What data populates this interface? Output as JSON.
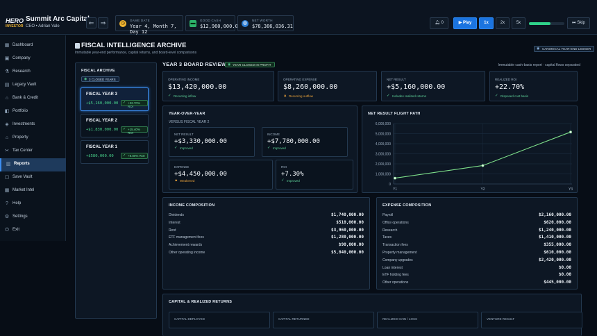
{
  "topbar": {
    "logo_top": "HERO",
    "logo_bottom": "INVESTOR",
    "company": "Summit Arc Capital",
    "ceo": "CEO • Adrian Vale",
    "back_icon": "arrow-left-icon",
    "forward_icon": "arrow-right-icon",
    "game_date_label": "GAME DATE",
    "game_date": "Year 4, Month 7, Day 12",
    "cash_label": "GOOD CASH",
    "cash": "$12,960,000.00",
    "net_worth_label": "NET WORTH",
    "net_worth": "$78,386,036.31",
    "notifications": "0",
    "play": "Play",
    "speed_1": "1x",
    "speed_2": "2x",
    "speed_5": "5x",
    "skip": "Skip",
    "speed_progress": 0.6,
    "accent": "#1b74e0"
  },
  "sidebar": {
    "items": [
      {
        "label": "Dashboard",
        "icon": "dashboard-icon"
      },
      {
        "label": "Company",
        "icon": "company-icon"
      },
      {
        "label": "Research",
        "icon": "research-icon"
      },
      {
        "label": "Legacy Vault",
        "icon": "vault-icon"
      },
      {
        "label": "Bank & Credit",
        "icon": "bank-icon"
      },
      {
        "label": "Portfolio",
        "icon": "portfolio-icon"
      },
      {
        "label": "Investments",
        "icon": "investments-icon"
      },
      {
        "label": "Property",
        "icon": "property-icon"
      },
      {
        "label": "Tax Center",
        "icon": "tax-icon"
      },
      {
        "label": "Reports",
        "icon": "reports-icon"
      },
      {
        "label": "Save Vault",
        "icon": "save-icon"
      },
      {
        "label": "Market Intel",
        "icon": "market-icon"
      },
      {
        "label": "Help",
        "icon": "help-icon"
      },
      {
        "label": "Settings",
        "icon": "gear-icon"
      },
      {
        "label": "Exit",
        "icon": "exit-icon"
      }
    ],
    "active": "Reports"
  },
  "page": {
    "title": "FISCAL INTELLIGENCE ARCHIVE",
    "subtitle": "Immutable year-end performance, capital returns, and board-level comparisons",
    "badge": "CANONICAL YEAR-END LEDGER"
  },
  "archive": {
    "title": "FISCAL ARCHIVE",
    "closed_chip": "3 CLOSED YEARS",
    "years": [
      {
        "name": "FISCAL YEAR 3",
        "value": "+$5,160,000.00",
        "badge": "+22.70% ROI"
      },
      {
        "name": "FISCAL YEAR 2",
        "value": "+$1,830,000.00",
        "badge": "+15.40% ROI"
      },
      {
        "name": "FISCAL YEAR 1",
        "value": "+$580,000.00",
        "badge": "+8.80% ROI"
      }
    ]
  },
  "review": {
    "title": "YEAR 3 BOARD REVIEW",
    "chip": "YEAR CLOSED IN PROFIT",
    "note": "Immutable cash-basis report · capital flows separated",
    "kpis": [
      {
        "label": "OPERATING INCOME",
        "value": "$13,420,000.00",
        "sub": "Recurring inflow",
        "tone": "g"
      },
      {
        "label": "OPERATING EXPENSE",
        "value": "$8,260,000.00",
        "sub": "Recurring outflow",
        "tone": "o"
      },
      {
        "label": "NET RESULT",
        "value": "+$5,160,000.00",
        "sub": "Includes realized returns",
        "tone": "g"
      },
      {
        "label": "REALIZED ROI",
        "value": "+22.70%",
        "sub": "Disposed cost basis",
        "tone": "g"
      }
    ]
  },
  "yoy": {
    "title": "YEAR-OVER-YEAR",
    "versus": "VERSUS FISCAL YEAR 2",
    "cards": [
      {
        "label": "NET RESULT",
        "value": "+$3,330,000.00",
        "sub": "Improved",
        "tone": "g"
      },
      {
        "label": "INCOME",
        "value": "+$7,780,000.00",
        "sub": "Improved",
        "tone": "g"
      },
      {
        "label": "EXPENSE",
        "value": "+$4,450,000.00",
        "sub": "Weakened",
        "tone": "o"
      },
      {
        "label": "ROI",
        "value": "+7.30%",
        "sub": "Improved",
        "tone": "g"
      }
    ]
  },
  "chart_data": {
    "type": "line",
    "title": "NET RESULT FLIGHT PATH",
    "categories": [
      "Y1",
      "Y2",
      "Y3"
    ],
    "series": [
      {
        "values": [
          580000,
          1830000,
          5160000
        ]
      }
    ],
    "ylim": [
      0,
      6000000
    ],
    "yticks": [
      "0",
      "1,000,000",
      "2,000,000",
      "3,000,000",
      "4,000,000",
      "5,000,000",
      "6,000,000"
    ],
    "grid": true,
    "color": "#7ee08a"
  },
  "income": {
    "title": "INCOME COMPOSITION",
    "rows": [
      {
        "label": "Dividends",
        "value": "$1,740,000.00"
      },
      {
        "label": "Interest",
        "value": "$510,000.00"
      },
      {
        "label": "Rent",
        "value": "$3,960,000.00"
      },
      {
        "label": "ETF management fees",
        "value": "$1,280,000.00"
      },
      {
        "label": "Achievement rewards",
        "value": "$90,000.00"
      },
      {
        "label": "Other operating income",
        "value": "$5,840,000.00"
      }
    ]
  },
  "expense": {
    "title": "EXPENSE COMPOSITION",
    "rows": [
      {
        "label": "Payroll",
        "value": "$2,160,000.00"
      },
      {
        "label": "Office operations",
        "value": "$620,000.00"
      },
      {
        "label": "Research",
        "value": "$1,240,000.00"
      },
      {
        "label": "Taxes",
        "value": "$1,410,000.00"
      },
      {
        "label": "Transaction fees",
        "value": "$355,000.00"
      },
      {
        "label": "Property management",
        "value": "$610,000.00"
      },
      {
        "label": "Company upgrades",
        "value": "$2,420,000.00"
      },
      {
        "label": "Loan interest",
        "value": "$0.00"
      },
      {
        "label": "ETF holding fees",
        "value": "$0.00"
      },
      {
        "label": "Other operations",
        "value": "$445,000.00"
      }
    ]
  },
  "capital": {
    "title": "CAPITAL & REALIZED RETURNS",
    "cards": [
      "CAPITAL DEPLOYED",
      "CAPITAL RETURNED",
      "REALIZED GAIN / LOSS",
      "VENTURE RESULT"
    ]
  }
}
